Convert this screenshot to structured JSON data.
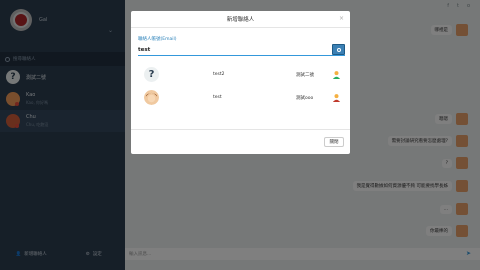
{
  "sidebar": {
    "user_name": "Gal",
    "search_placeholder": "搜尋聯絡人",
    "contacts": [
      {
        "name": "測試二號",
        "sub": "",
        "avatar": "question-avatar"
      },
      {
        "name": "Kao",
        "sub": "Kao, 你好嗎",
        "avatar": "man-avatar"
      },
      {
        "name": "Chu",
        "sub": "Chu, 吃飽沒",
        "avatar": "boy-avatar"
      }
    ],
    "add_contact_label": "新增聯絡人",
    "settings_label": "設定"
  },
  "main": {
    "social_icons": [
      "f",
      "t",
      "o"
    ],
    "messages": [
      {
        "text": "哪裡是"
      },
      {
        "text": "嗯嗯"
      },
      {
        "text": "需要討論研究看要怎麼處理?"
      },
      {
        "text": "?"
      },
      {
        "text": "我是覺得數據如何資源優不夠 可能要找學長姊"
      },
      {
        "text": "..."
      },
      {
        "text": "你最棒的"
      }
    ],
    "compose_placeholder": "輸入訊息..."
  },
  "modal": {
    "title": "新增聯絡人",
    "close_icon": "×",
    "field_label": "聯絡人帳號(Email)",
    "search_value": "test",
    "results": [
      {
        "account": "test2",
        "nickname": "測試二號",
        "avatar": "question-avatar"
      },
      {
        "account": "test",
        "nickname": "測試ooo",
        "avatar": "user-avatar"
      }
    ],
    "close_label": "關閉"
  },
  "colors": {
    "sidebar": "#2c3e50",
    "accent": "#3498db"
  }
}
